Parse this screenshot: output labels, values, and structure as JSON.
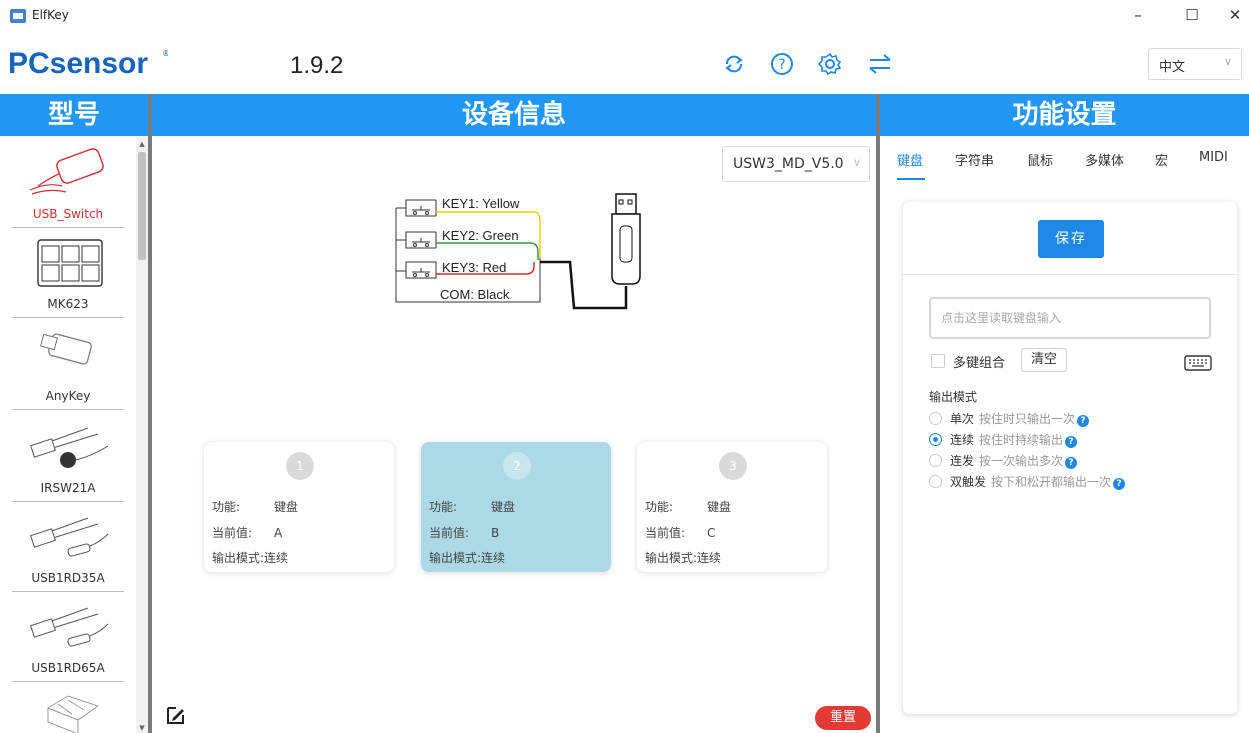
{
  "window": {
    "title": "ElfKey",
    "icon": "app-icon",
    "controls": [
      "–",
      "☐",
      "✕"
    ]
  },
  "header": {
    "logo": "PCsensor",
    "version": "1.9.2",
    "icons": [
      "refresh-icon",
      "help-icon",
      "settings-icon",
      "switch-icon"
    ],
    "language": "中文"
  },
  "sections": {
    "left_title": "型号",
    "center_title": "设备信息",
    "right_title": "功能设置"
  },
  "models": [
    {
      "label": "USB_Switch",
      "active": true
    },
    {
      "label": "MK623",
      "active": false
    },
    {
      "label": "AnyKey",
      "active": false
    },
    {
      "label": "IRSW21A",
      "active": false
    },
    {
      "label": "USB1RD35A",
      "active": false
    },
    {
      "label": "USB1RD65A",
      "active": false
    }
  ],
  "device": {
    "selected_version": "USW3_MD_V5.0",
    "wiring": {
      "key1": "KEY1: Yellow",
      "key2": "KEY2: Green",
      "key3": "KEY3: Red",
      "com": "COM: Black"
    }
  },
  "key_cards": [
    {
      "num": "1",
      "func_label": "功能:",
      "func": "键盘",
      "value_label": "当前值:",
      "value": "A",
      "mode_label": "输出模式:",
      "mode": "连续",
      "active": false
    },
    {
      "num": "2",
      "func_label": "功能:",
      "func": "键盘",
      "value_label": "当前值:",
      "value": "B",
      "mode_label": "输出模式:",
      "mode": "连续",
      "active": true
    },
    {
      "num": "3",
      "func_label": "功能:",
      "func": "键盘",
      "value_label": "当前值:",
      "value": "C",
      "mode_label": "输出模式:",
      "mode": "连续",
      "active": false
    }
  ],
  "reset_label": "重置",
  "tabs": [
    {
      "label": "键盘",
      "active": true
    },
    {
      "label": "字符串",
      "active": false
    },
    {
      "label": "鼠标",
      "active": false
    },
    {
      "label": "多媒体",
      "active": false
    },
    {
      "label": "宏",
      "active": false
    },
    {
      "label": "MIDI",
      "active": false
    }
  ],
  "settings": {
    "save_label": "保存",
    "input_placeholder": "点击这里读取键盘输入",
    "combo_label": "多键组合",
    "clear_label": "清空",
    "mode_title": "输出模式",
    "modes": [
      {
        "name": "单次",
        "desc": "按住时只输出一次",
        "selected": false
      },
      {
        "name": "连续",
        "desc": "按住时持续输出",
        "selected": true
      },
      {
        "name": "连发",
        "desc": "按一次输出多次",
        "selected": false
      },
      {
        "name": "双触发",
        "desc": "按下和松开都输出一次",
        "selected": false
      }
    ]
  },
  "colors": {
    "accent": "#2196f3",
    "primary_button": "#1e88e5",
    "danger": "#e53935",
    "active_card": "#add8e6",
    "active_model": "#d32f2f"
  }
}
